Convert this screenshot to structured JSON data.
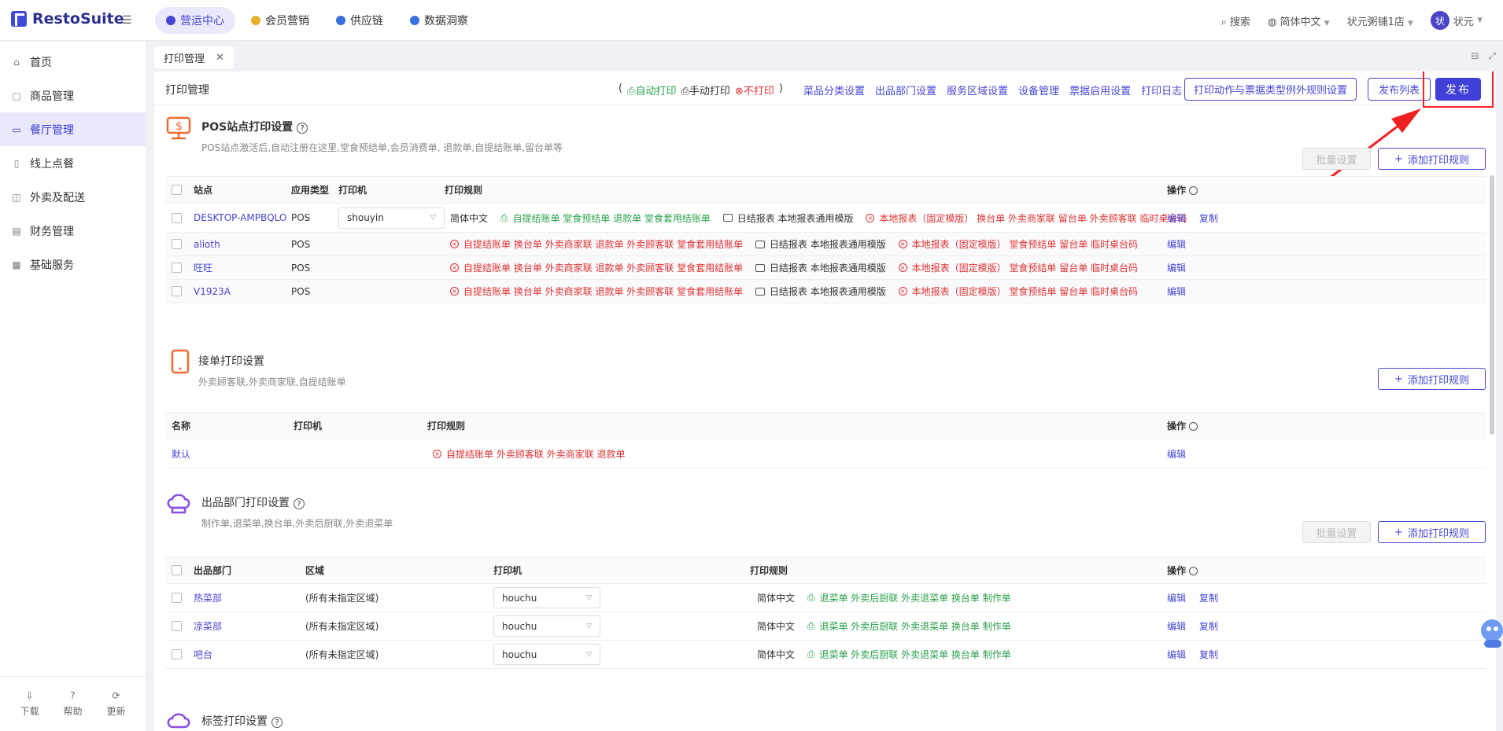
{
  "app": {
    "logo": "RestoSuite"
  },
  "topnav": [
    {
      "label": "营运中心",
      "active": true,
      "color": "#4646d6"
    },
    {
      "label": "会员营销",
      "active": false,
      "color": "#e7b12e"
    },
    {
      "label": "供应链",
      "active": false,
      "color": "#3b6fe0"
    },
    {
      "label": "数据洞察",
      "active": false,
      "color": "#3b6fe0"
    }
  ],
  "topright": {
    "search": "搜索",
    "language": "简体中文",
    "store": "状元粥铺1店",
    "avatar_char": "状",
    "user": "状元"
  },
  "sidebar": {
    "items": [
      {
        "label": "首页",
        "icon": "home-icon",
        "active": false
      },
      {
        "label": "商品管理",
        "icon": "box-icon",
        "active": false
      },
      {
        "label": "餐厅管理",
        "icon": "card-icon",
        "active": true
      },
      {
        "label": "线上点餐",
        "icon": "phone-icon",
        "active": false
      },
      {
        "label": "外卖及配送",
        "icon": "bag-icon",
        "active": false
      },
      {
        "label": "财务管理",
        "icon": "folder-icon",
        "active": false
      },
      {
        "label": "基础服务",
        "icon": "grid-icon",
        "active": false
      }
    ],
    "bottom": [
      "下载",
      "帮助",
      "更新"
    ]
  },
  "tab": {
    "label": "打印管理"
  },
  "toolbar": {
    "title": "打印管理",
    "legend_auto": "自动打印",
    "legend_manual": "手动打印",
    "legend_none": "不打印",
    "links": [
      "菜品分类设置",
      "出品部门设置",
      "服务区域设置",
      "设备管理",
      "票据启用设置",
      "打印日志"
    ],
    "rules_button": "打印动作与票据类型例外规则设置",
    "publish_list": "发布列表",
    "publish": "发布"
  },
  "pos_section": {
    "title": "POS站点打印设置",
    "desc": "POS站点激活后,自动注册在这里,堂食预结单,会员消费单, 退款单,自提结账单,留台单等",
    "batch": "批量设置",
    "add": "添加打印规则",
    "headers": [
      "站点",
      "应用类型",
      "打印机",
      "打印规则",
      "操作"
    ],
    "rows": [
      {
        "site": "DESKTOP-AMPBQLO",
        "type": "POS",
        "printer": "shouyin",
        "lang": "简体中文",
        "g": "自提结账单  堂食预结单  退款单  堂食套用结账单",
        "k": "日结报表  本地报表通用模版",
        "r": "本地报表（固定模版）  换台单  外卖商家联  留台单  外卖顾客联  临时桌台码",
        "ops": [
          "编辑",
          "复制"
        ]
      },
      {
        "site": "alioth",
        "type": "POS",
        "printer": "",
        "lang": "",
        "r1": "自提结账单  换台单  外卖商家联  退款单  外卖顾客联  堂食套用结账单",
        "k": "日结报表  本地报表通用模版",
        "r": "本地报表（固定模版）  堂食预结单  留台单  临时桌台码",
        "ops": [
          "编辑"
        ]
      },
      {
        "site": "旺旺",
        "type": "POS",
        "printer": "",
        "lang": "",
        "r1": "自提结账单  换台单  外卖商家联  退款单  外卖顾客联  堂食套用结账单",
        "k": "日结报表  本地报表通用模版",
        "r": "本地报表（固定模版）  堂食预结单  留台单  临时桌台码",
        "ops": [
          "编辑"
        ]
      },
      {
        "site": "V1923A",
        "type": "POS",
        "printer": "",
        "lang": "",
        "r1": "自提结账单  换台单  外卖商家联  退款单  外卖顾客联  堂食套用结账单",
        "k": "日结报表  本地报表通用模版",
        "r": "本地报表（固定模版）  堂食预结单  留台单  临时桌台码",
        "ops": [
          "编辑"
        ]
      }
    ]
  },
  "order_section": {
    "title": "接单打印设置",
    "desc": "外卖顾客联,外卖商家联,自提结账单",
    "add": "添加打印规则",
    "headers": [
      "名称",
      "打印机",
      "打印规则",
      "操作"
    ],
    "rows": [
      {
        "name": "默认",
        "r": "自提结账单  外卖顾客联  外卖商家联  退款单",
        "op": "编辑"
      }
    ]
  },
  "dept_section": {
    "title": "出品部门打印设置",
    "desc": "制作单,退菜单,换台单,外卖后厨联,外卖退菜单",
    "batch": "批量设置",
    "add": "添加打印规则",
    "headers": [
      "出品部门",
      "区域",
      "打印机",
      "打印规则",
      "操作"
    ],
    "rows": [
      {
        "dept": "热菜部",
        "area": "(所有未指定区域)",
        "printer": "houchu",
        "lang": "简体中文",
        "g": "退菜单  外卖后厨联  外卖退菜单  换台单  制作单",
        "ops": [
          "编辑",
          "复制"
        ]
      },
      {
        "dept": "凉菜部",
        "area": "(所有未指定区域)",
        "printer": "houchu",
        "lang": "简体中文",
        "g": "退菜单  外卖后厨联  外卖退菜单  换台单  制作单",
        "ops": [
          "编辑",
          "复制"
        ]
      },
      {
        "dept": "吧台",
        "area": "(所有未指定区域)",
        "printer": "houchu",
        "lang": "简体中文",
        "g": "退菜单  外卖后厨联  外卖退菜单  换台单  制作单",
        "ops": [
          "编辑",
          "复制"
        ]
      }
    ]
  },
  "label_section": {
    "title": "标签打印设置"
  }
}
